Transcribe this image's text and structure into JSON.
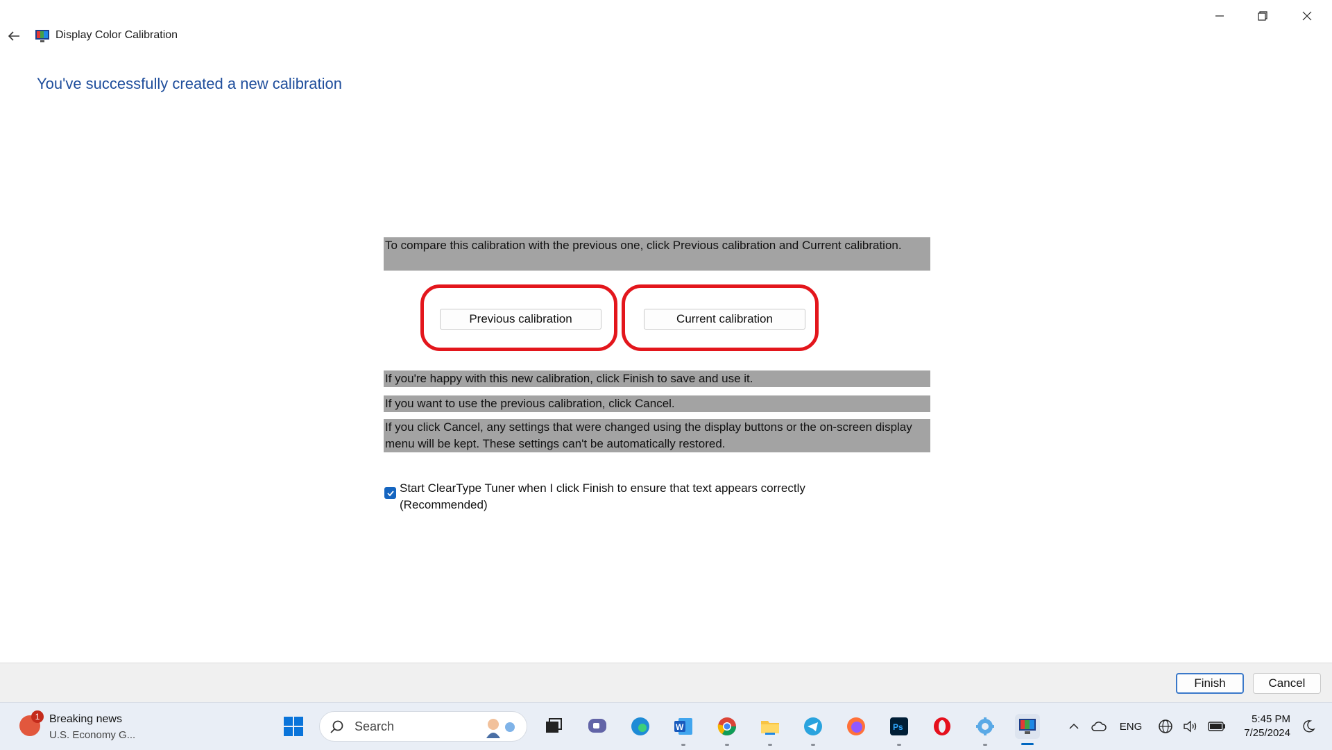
{
  "window": {
    "title": "Display Color Calibration",
    "heading": "You've successfully created a new calibration",
    "compare_text": "To compare this calibration with the previous one, click Previous calibration and Current calibration.",
    "previous_button": "Previous calibration",
    "current_button": "Current calibration",
    "finish_text": "If you're happy with this new calibration, click Finish to save and use it.",
    "cancel_text": "If you want to use the previous calibration, click Cancel.",
    "cancel_note": "If you click Cancel, any settings that were changed using the display buttons or the on-screen display menu will be kept. These settings can't be automatically restored.",
    "checkbox_label": "Start ClearType Tuner when I click Finish to ensure that text appears correctly (Recommended)",
    "checkbox_checked": true,
    "finish_button": "Finish",
    "cancel_button": "Cancel"
  },
  "taskbar": {
    "news_badge": "1",
    "news_title": "Breaking news",
    "news_subtitle": "U.S. Economy G...",
    "search_placeholder": "Search",
    "language": "ENG",
    "time": "5:45 PM",
    "date": "7/25/2024",
    "apps": [
      "start-icon",
      "task-view-icon",
      "chat-icon",
      "edge-icon",
      "word-icon",
      "chrome-icon",
      "file-explorer-icon",
      "telegram-icon",
      "firefox-icon",
      "photoshop-icon",
      "opera-icon",
      "settings-app-icon",
      "color-calibration-app-icon"
    ]
  },
  "colors": {
    "heading": "#1f4e9c",
    "highlight": "#a3a3a3",
    "callout": "#e3161c",
    "accent": "#0067c0"
  }
}
